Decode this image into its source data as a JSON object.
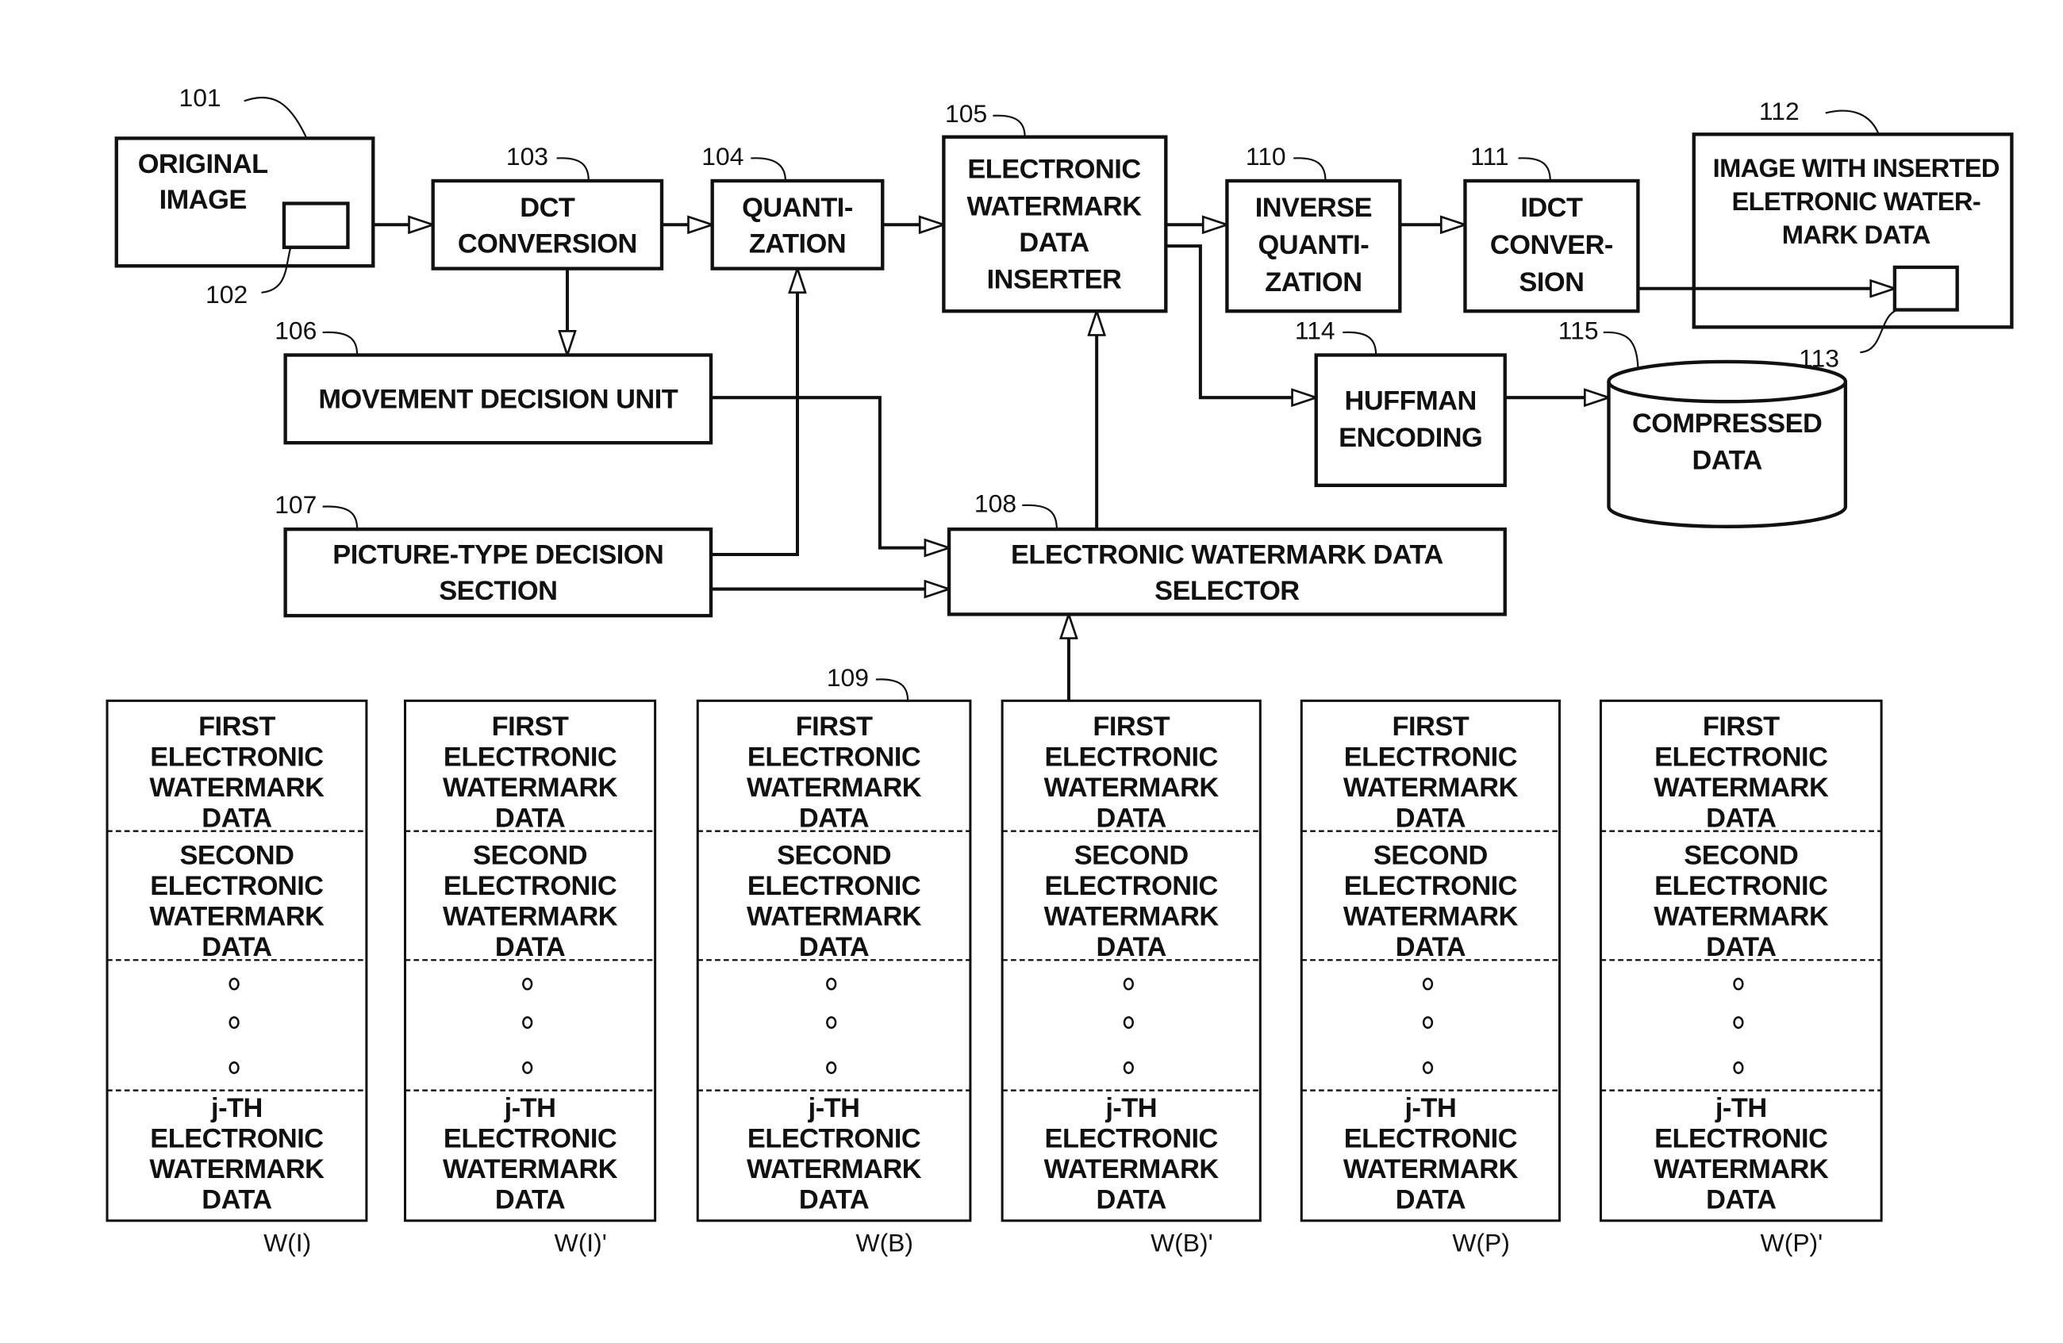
{
  "diagram": {
    "type": "block-diagram",
    "blocks": {
      "original_image": {
        "ref": "101",
        "lines": [
          "ORIGINAL",
          "IMAGE"
        ],
        "inner_ref": "102"
      },
      "dct": {
        "ref": "103",
        "lines": [
          "DCT",
          "CONVERSION"
        ]
      },
      "quantization": {
        "ref": "104",
        "lines": [
          "QUANTI-",
          "ZATION"
        ]
      },
      "inserter": {
        "ref": "105",
        "lines": [
          "ELECTRONIC",
          "WATERMARK",
          "DATA",
          "INSERTER"
        ]
      },
      "movement": {
        "ref": "106",
        "lines": [
          "MOVEMENT DECISION UNIT"
        ]
      },
      "picture_type": {
        "ref": "107",
        "lines": [
          "PICTURE-TYPE DECISION",
          "SECTION"
        ]
      },
      "selector": {
        "ref": "108",
        "lines": [
          "ELECTRONIC WATERMARK DATA",
          "SELECTOR"
        ]
      },
      "inverse_quant": {
        "ref": "110",
        "lines": [
          "INVERSE",
          "QUANTI-",
          "ZATION"
        ]
      },
      "idct": {
        "ref": "111",
        "lines": [
          "IDCT",
          "CONVER-",
          "SION"
        ]
      },
      "output_image": {
        "ref": "112",
        "lines": [
          "IMAGE WITH INSERTED",
          "ELETRONIC WATER-",
          "MARK DATA"
        ],
        "inner_ref": "113"
      },
      "huffman": {
        "ref": "114",
        "lines": [
          "HUFFMAN",
          "ENCODING"
        ]
      },
      "compressed": {
        "ref": "115",
        "lines": [
          "COMPRESSED",
          "DATA"
        ]
      }
    },
    "table_ref": "109",
    "table_cells": {
      "first": [
        "FIRST",
        "ELECTRONIC",
        "WATERMARK",
        "DATA"
      ],
      "second": [
        "SECOND",
        "ELECTRONIC",
        "WATERMARK",
        "DATA"
      ],
      "jth": [
        "j-TH",
        "ELECTRONIC",
        "WATERMARK",
        "DATA"
      ]
    },
    "tables": [
      {
        "caption": "W(I)"
      },
      {
        "caption": "W(I)'"
      },
      {
        "caption": "W(B)"
      },
      {
        "caption": "W(B)'"
      },
      {
        "caption": "W(P)"
      },
      {
        "caption": "W(P)'"
      }
    ]
  }
}
